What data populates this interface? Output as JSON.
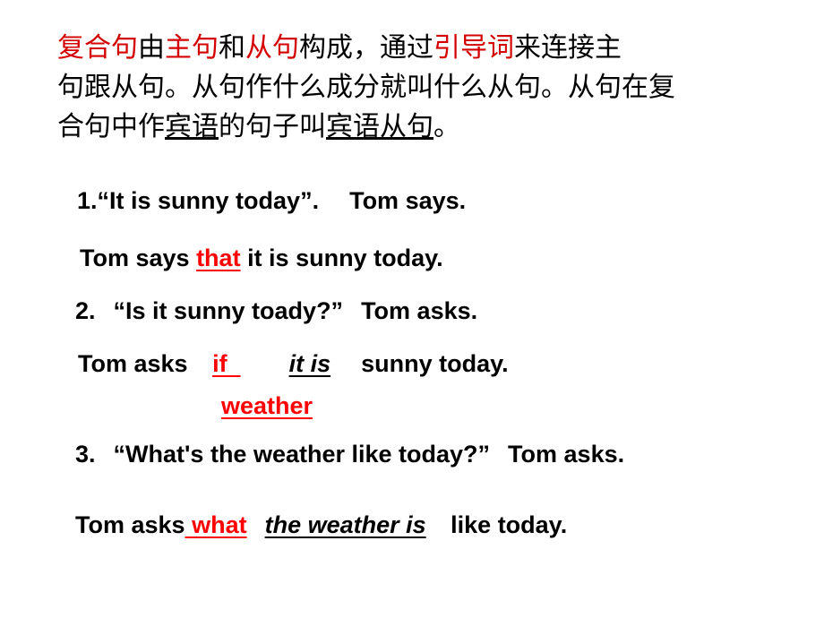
{
  "slide": {
    "background_color": "#ffffff",
    "accent_red": "#ff0000",
    "chinese_red": "#d40000"
  },
  "definition": {
    "line1": {
      "seg1_red": "复合句",
      "seg2": "由",
      "seg3_red": "主句",
      "seg4": "和",
      "seg5_red": "从句",
      "seg6": "构成，通过",
      "seg7_red": "引导词",
      "seg8": "来连接主"
    },
    "line2": {
      "text": "句跟从句。从句作什么成分就叫什么从句。从句在复"
    },
    "line3": {
      "seg1": "合句中作",
      "seg2_underline": "宾语",
      "seg3": "的句子叫",
      "seg4_underline": "宾语从句",
      "seg5": "。"
    }
  },
  "examples": [
    {
      "id": 1,
      "prompt": {
        "number": "1.",
        "quote": "“It is sunny today”.",
        "attribution": "Tom says."
      },
      "answer": {
        "before": "Tom says ",
        "key": "that",
        "after": " it is sunny today."
      }
    },
    {
      "id": 2,
      "prompt": {
        "number": "2.",
        "quote": "“Is it sunny toady?”",
        "attribution": "Tom asks."
      },
      "answer": {
        "before": "Tom asks ",
        "key": "if",
        "subject": "it is",
        "after": "sunny today.",
        "alt_key": "weather"
      }
    },
    {
      "id": 3,
      "prompt": {
        "number": "3.",
        "quote": "“What's the weather like today?”",
        "attribution": "Tom asks."
      },
      "answer": {
        "before": "Tom asks",
        "key": "what",
        "subject": "the weather is",
        "after": " like today."
      }
    }
  ]
}
